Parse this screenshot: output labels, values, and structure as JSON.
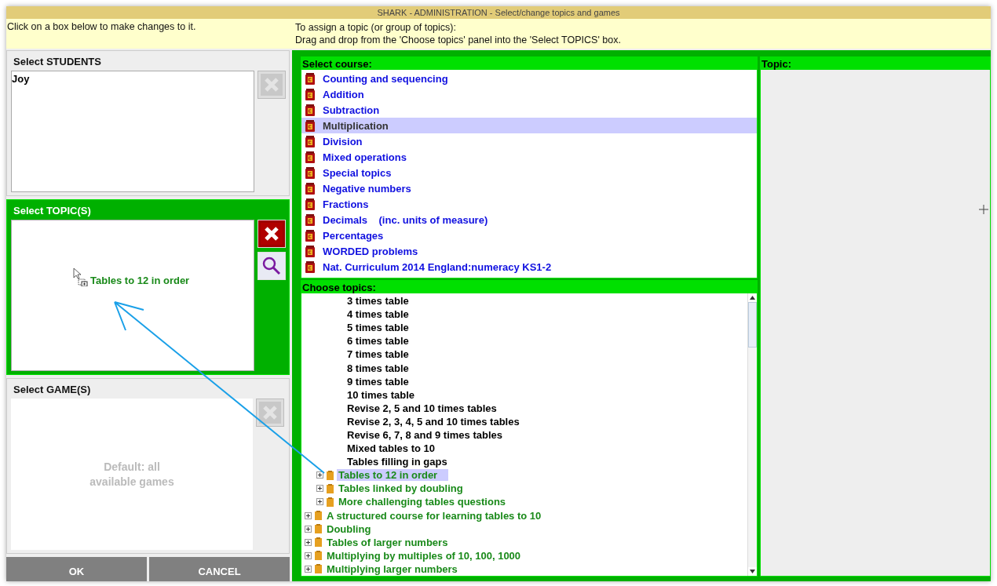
{
  "window": {
    "title": "SHARK - ADMINISTRATION - Select/change topics and games"
  },
  "instructions": {
    "left": "Click on a box below to make changes to it.",
    "right": [
      "To assign a topic (or group of topics):",
      "Drag and drop from the 'Choose topics' panel into the 'Select TOPICS' box."
    ]
  },
  "students": {
    "title": "Select STUDENTS",
    "items": [
      "Joy"
    ],
    "remove_disabled": true
  },
  "selected_topics": {
    "title": "Select TOPIC(S)",
    "active": true,
    "remove_disabled": false,
    "drag_item": "Tables to 12 in order"
  },
  "games": {
    "title": "Select GAME(S)",
    "placeholder": "Default: all available games",
    "remove_disabled": true
  },
  "buttons": [
    "OK",
    "CANCEL"
  ],
  "courses": {
    "title": "Select course:",
    "items": [
      {
        "label": "Counting and sequencing",
        "selected": false
      },
      {
        "label": "Addition",
        "selected": false
      },
      {
        "label": "Subtraction",
        "selected": false
      },
      {
        "label": "Multiplication",
        "selected": true
      },
      {
        "label": "Division",
        "selected": false
      },
      {
        "label": "Mixed operations",
        "selected": false
      },
      {
        "label": "Special topics",
        "selected": false
      },
      {
        "label": "Negative numbers",
        "selected": false
      },
      {
        "label": "Fractions",
        "selected": false
      },
      {
        "label": "Decimals    (inc. units of measure)",
        "selected": false
      },
      {
        "label": "Percentages",
        "selected": false
      },
      {
        "label": "WORDED problems",
        "selected": false
      },
      {
        "label": "Nat. Curriculum 2014 England:numeracy KS1-2",
        "selected": false
      }
    ]
  },
  "topics": {
    "title": "Choose topics:",
    "tree": [
      {
        "children": [
          {
            "children": [
              {
                "kind": "leaf",
                "label": "3 times table",
                "selected": false
              },
              {
                "kind": "leaf",
                "label": "4 times table",
                "selected": false
              },
              {
                "kind": "leaf",
                "label": "5 times table",
                "selected": false
              },
              {
                "kind": "leaf",
                "label": "6 times table",
                "selected": false
              },
              {
                "kind": "leaf",
                "label": "7 times table",
                "selected": false
              },
              {
                "kind": "leaf",
                "label": "8 times table",
                "selected": false
              },
              {
                "kind": "leaf",
                "label": "9 times table",
                "selected": false
              },
              {
                "kind": "leaf",
                "label": "10 times table",
                "selected": false
              },
              {
                "kind": "leaf",
                "label": "Revise 2, 5 and 10 times tables",
                "selected": false
              },
              {
                "kind": "leaf",
                "label": "Revise 2, 3, 4, 5 and 10 times tables",
                "selected": false
              },
              {
                "kind": "leaf",
                "label": "Revise 6, 7, 8 and 9 times tables",
                "selected": false
              },
              {
                "kind": "leaf",
                "label": "Mixed tables to 10",
                "selected": false
              },
              {
                "kind": "leaf",
                "label": "Tables filling in gaps",
                "selected": false
              }
            ]
          },
          {
            "kind": "group",
            "label": "Tables to 12 in order",
            "expanded": false,
            "selected": true
          },
          {
            "kind": "group",
            "label": "Tables linked by doubling",
            "expanded": false,
            "selected": false
          },
          {
            "kind": "group",
            "label": "More challenging tables questions",
            "expanded": false,
            "selected": false
          }
        ]
      },
      {
        "kind": "group",
        "label": "A structured course for learning tables to 10",
        "expanded": false,
        "selected": false
      },
      {
        "kind": "group",
        "label": "Doubling",
        "expanded": false,
        "selected": false
      },
      {
        "kind": "group",
        "label": "Tables of larger numbers",
        "expanded": false,
        "selected": false
      },
      {
        "kind": "group",
        "label": "Multiplying by multiples of 10, 100, 1000",
        "expanded": false,
        "selected": false
      },
      {
        "kind": "group",
        "label": "Multiplying larger numbers",
        "expanded": false,
        "selected": false
      }
    ]
  },
  "topic_panel": {
    "title": "Topic:"
  }
}
